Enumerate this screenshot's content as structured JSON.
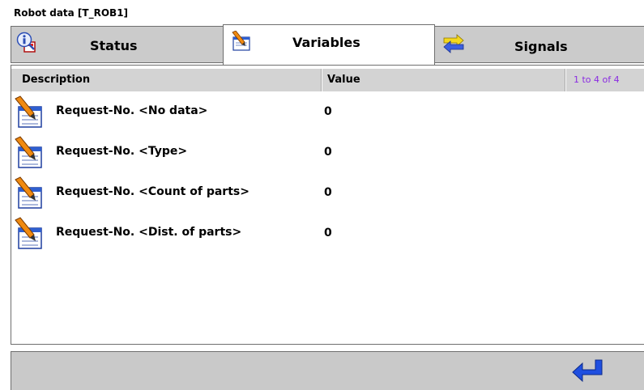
{
  "window": {
    "title": "Robot data [T_ROB1]"
  },
  "tabs": [
    {
      "label": "Status",
      "icon": "info-icon",
      "active": false
    },
    {
      "label": "Variables",
      "icon": "pencil-icon",
      "active": true
    },
    {
      "label": "Signals",
      "icon": "swap-arrows-icon",
      "active": false
    }
  ],
  "table": {
    "columns": {
      "description": "Description",
      "value": "Value",
      "range": "1 to 4 of 4"
    },
    "rows": [
      {
        "icon": "pencil-icon",
        "description": "Request-No. <No data>",
        "value": "0"
      },
      {
        "icon": "pencil-icon",
        "description": "Request-No. <Type>",
        "value": "0"
      },
      {
        "icon": "pencil-icon",
        "description": "Request-No. <Count of parts>",
        "value": "0"
      },
      {
        "icon": "pencil-icon",
        "description": "Request-No. <Dist. of parts>",
        "value": "0"
      }
    ]
  },
  "bottombar": {
    "enter_icon": "enter-arrow-icon"
  },
  "colors": {
    "tab_bg": "#cbcbcb",
    "header_bg": "#d3d3d3",
    "accent_blue": "#1f4fe0",
    "range_text": "#8a2be2"
  }
}
